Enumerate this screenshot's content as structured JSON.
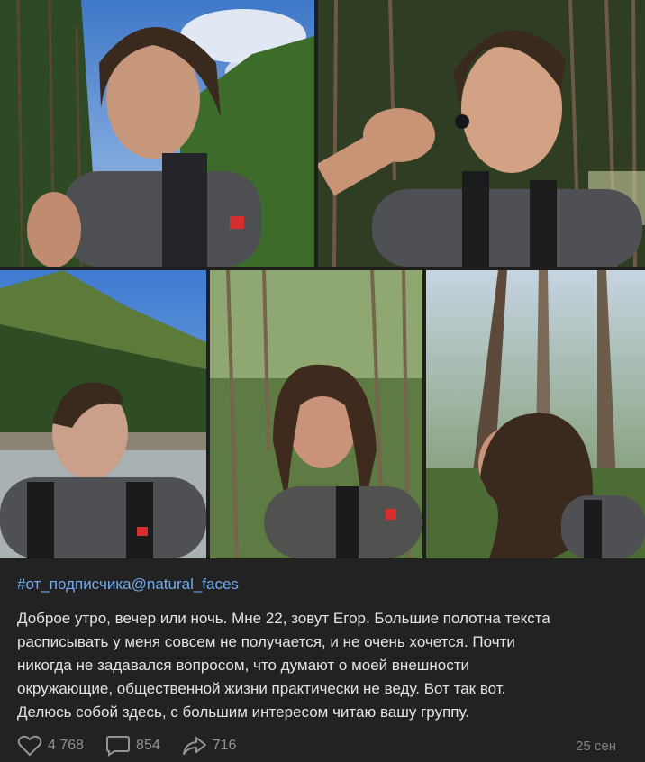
{
  "post": {
    "photos": [
      {
        "name": "selfie-mountain-sky"
      },
      {
        "name": "selfie-earbud-forest"
      },
      {
        "name": "profile-river-mountain"
      },
      {
        "name": "selfie-forest-trees"
      },
      {
        "name": "profile-tall-trees"
      }
    ],
    "hashtag": "#от_подписчика@natural_faces",
    "text_lines": [
      "Доброе утро, вечер или ночь. Мне 22, зовут Егор. Большие полотна текста",
      "расписывать у меня совсем не получается, и не очень хочется. Почти",
      "никогда не задавался вопросом, что думают о моей внешности",
      "окружающие, общественной жизни практически не веду. Вот так вот.",
      "Делюсь собой здесь, с большим интересом читаю вашу группу."
    ],
    "actions": {
      "likes": "4 768",
      "comments": "854",
      "shares": "716",
      "like_icon": "heart-icon",
      "comment_icon": "comment-icon",
      "share_icon": "share-arrow-icon"
    },
    "date": "25 сен"
  },
  "colors": {
    "background": "#222222",
    "hashtag": "#71aaeb",
    "text": "#e1e3e6",
    "muted": "#939393"
  }
}
